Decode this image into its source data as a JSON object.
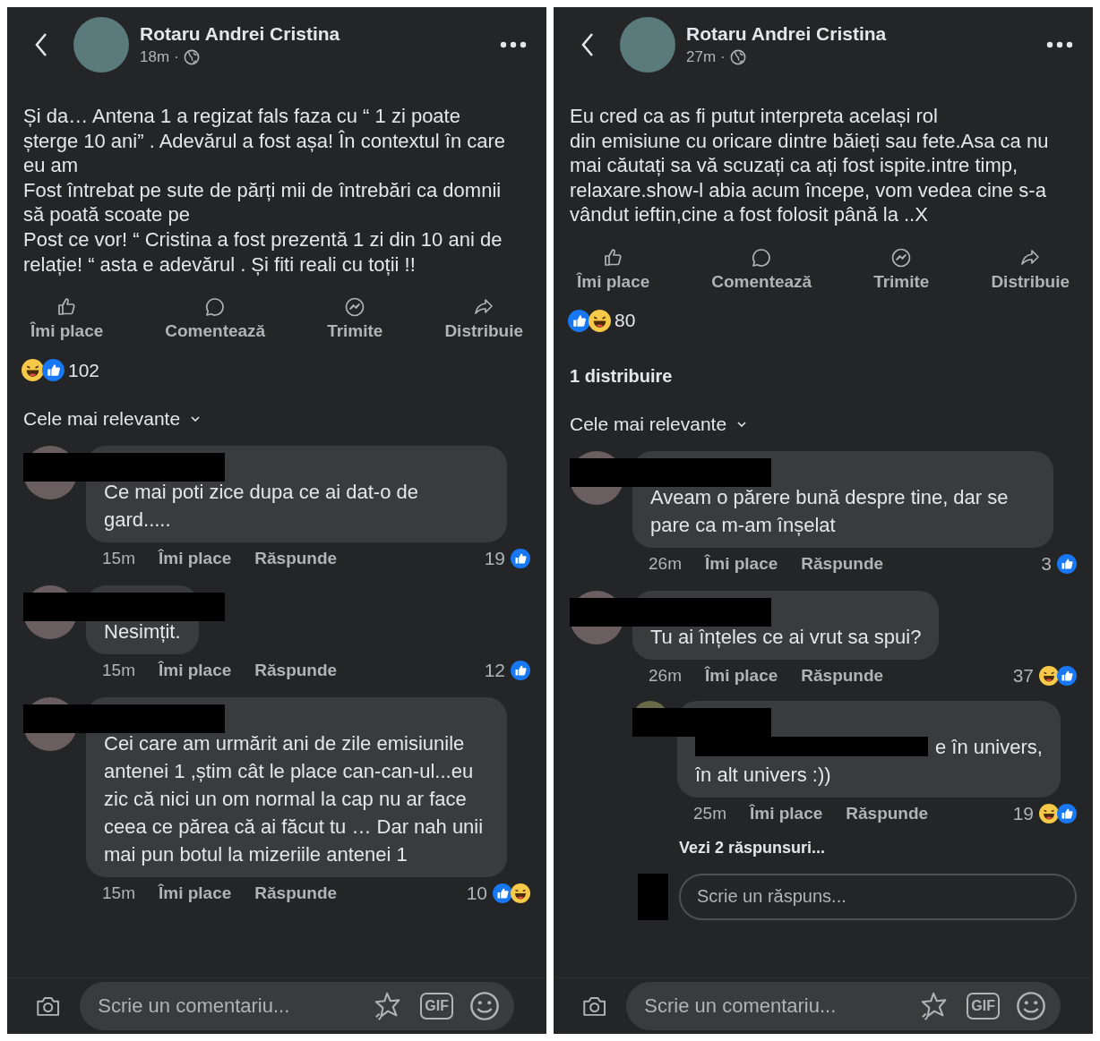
{
  "panels": [
    {
      "header": {
        "author": "Rotaru Andrei Cristina",
        "time": "18m",
        "separator": "·"
      },
      "post_text": "Și da… Antena 1 a regizat fals faza cu “ 1 zi poate șterge 10 ani” . Adevărul a fost așa! În contextul în care eu am\nFost întrebat pe sute de părți mii de întrebări ca domnii să poată scoate pe\nPost ce vor! “ Cristina a fost prezentă 1 zi din 10 ani de relație! “ asta e adevărul . Și fiti reali cu toții !!",
      "actions": [
        {
          "kind": "like",
          "label": "Îmi place"
        },
        {
          "kind": "comment",
          "label": "Comentează"
        },
        {
          "kind": "send",
          "label": "Trimite"
        },
        {
          "kind": "share",
          "label": "Distribuie"
        }
      ],
      "reactions": {
        "icons": [
          {
            "kind": "haha"
          },
          {
            "kind": "like"
          }
        ],
        "count": "102"
      },
      "sort_label": "Cele mai relevante",
      "comments": [
        {
          "author_redacted": true,
          "text": "Ce mai poti zice dupa ce ai dat-o de gard.....",
          "time": "15m",
          "like_label": "Îmi place",
          "reply_label": "Răspunde",
          "count": "19",
          "reactions": [
            {
              "kind": "like"
            }
          ]
        },
        {
          "author_redacted": true,
          "text": "Nesimțit.",
          "time": "15m",
          "like_label": "Îmi place",
          "reply_label": "Răspunde",
          "count": "12",
          "reactions": [
            {
              "kind": "like"
            }
          ]
        },
        {
          "author_redacted": true,
          "text": "Cei care am urmărit ani de zile emisiunile antenei 1 ,știm cât le place can-can-ul...eu zic că nici un om normal la cap nu ar face ceea ce părea că ai făcut tu … Dar nah unii mai pun botul la mizeriile antenei 1",
          "time": "15m",
          "like_label": "Îmi place",
          "reply_label": "Răspunde",
          "count": "10",
          "reactions": [
            {
              "kind": "like"
            },
            {
              "kind": "haha"
            }
          ]
        }
      ],
      "composer": {
        "placeholder": "Scrie un comentariu...",
        "gif_label": "GIF"
      }
    },
    {
      "header": {
        "author": "Rotaru Andrei Cristina",
        "time": "27m",
        "separator": "·"
      },
      "post_text": "Eu cred ca as fi putut interpreta același rol\ndin emisiune cu oricare dintre băieți sau fete.Asa ca nu mai căutați sa vă scuzați ca ați fost ispite.intre timp, relaxare.show-l abia acum începe, vom vedea cine s-a vândut ieftin,cine a fost folosit până la ..X",
      "actions": [
        {
          "kind": "like",
          "label": "Îmi place"
        },
        {
          "kind": "comment",
          "label": "Comentează"
        },
        {
          "kind": "send",
          "label": "Trimite"
        },
        {
          "kind": "share",
          "label": "Distribuie"
        }
      ],
      "reactions": {
        "icons": [
          {
            "kind": "like"
          },
          {
            "kind": "haha"
          }
        ],
        "count": "80"
      },
      "shares": "1 distribuire",
      "sort_label": "Cele mai relevante",
      "comments": [
        {
          "author_redacted": true,
          "text": "Aveam o părere bună despre tine, dar se pare ca m-am înșelat",
          "time": "26m",
          "like_label": "Îmi place",
          "reply_label": "Răspunde",
          "count": "3",
          "reactions": [
            {
              "kind": "like"
            }
          ]
        },
        {
          "author_redacted": true,
          "text": "Tu ai înțeles ce ai vrut sa spui?",
          "time": "26m",
          "like_label": "Îmi place",
          "reply_label": "Răspunde",
          "count": "37",
          "reactions": [
            {
              "kind": "haha"
            },
            {
              "kind": "like"
            }
          ],
          "replies": [
            {
              "author_redacted": true,
              "mention_redacted": true,
              "text_after_mention": "e în univers,",
              "text": "în alt univers :))",
              "time": "25m",
              "like_label": "Îmi place",
              "reply_label": "Răspunde",
              "count": "19",
              "reactions": [
                {
                  "kind": "haha"
                },
                {
                  "kind": "like"
                }
              ]
            }
          ],
          "more_replies": "Vezi 2 răspunsuri...",
          "reply_field": {
            "placeholder": "Scrie un răspuns..."
          }
        }
      ],
      "composer": {
        "placeholder": "Scrie un comentariu...",
        "gif_label": "GIF"
      }
    }
  ]
}
